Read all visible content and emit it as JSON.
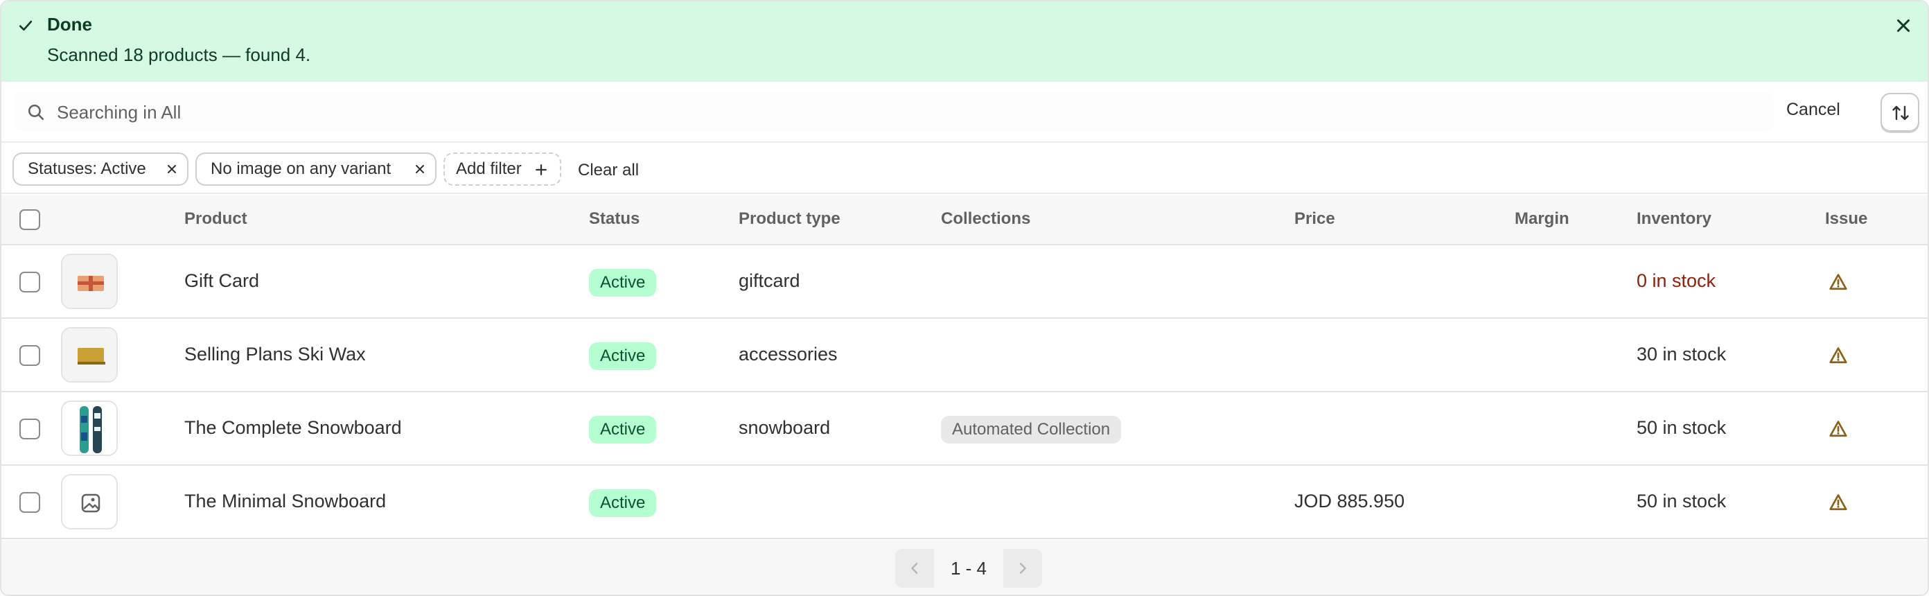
{
  "banner": {
    "title": "Done",
    "message": "Scanned 18 products — found 4."
  },
  "search": {
    "placeholder": "Searching in All",
    "cancel_label": "Cancel"
  },
  "filters": {
    "chips": [
      {
        "label": "Statuses: Active"
      },
      {
        "label": "No image on any variant"
      }
    ],
    "add_filter_label": "Add filter",
    "clear_all_label": "Clear all"
  },
  "table": {
    "headers": {
      "product": "Product",
      "status": "Status",
      "product_type": "Product type",
      "collections": "Collections",
      "price": "Price",
      "margin": "Margin",
      "inventory": "Inventory",
      "issue": "Issue"
    },
    "rows": [
      {
        "name": "Gift Card",
        "status": "Active",
        "product_type": "giftcard",
        "collection": "",
        "price": "",
        "inventory": "0 in stock",
        "thumb": "gift-card-image"
      },
      {
        "name": "Selling Plans Ski Wax",
        "status": "Active",
        "product_type": "accessories",
        "collection": "",
        "price": "",
        "inventory": "30 in stock",
        "thumb": "ski-wax-image"
      },
      {
        "name": "The Complete Snowboard",
        "status": "Active",
        "product_type": "snowboard",
        "collection": "Automated Collection",
        "price": "",
        "inventory": "50 in stock",
        "thumb": "snowboard-image"
      },
      {
        "name": "The Minimal Snowboard",
        "status": "Active",
        "product_type": "",
        "collection": "",
        "price": "JOD 885.950",
        "inventory": "50 in stock",
        "thumb": "placeholder-image-icon"
      }
    ]
  },
  "pagination": {
    "label": "1 - 4"
  },
  "colors": {
    "banner_bg": "#d5f9e3",
    "badge_active_bg": "#b4fed2",
    "zero_stock": "#8e1f0b",
    "warning": "#8a6116"
  }
}
